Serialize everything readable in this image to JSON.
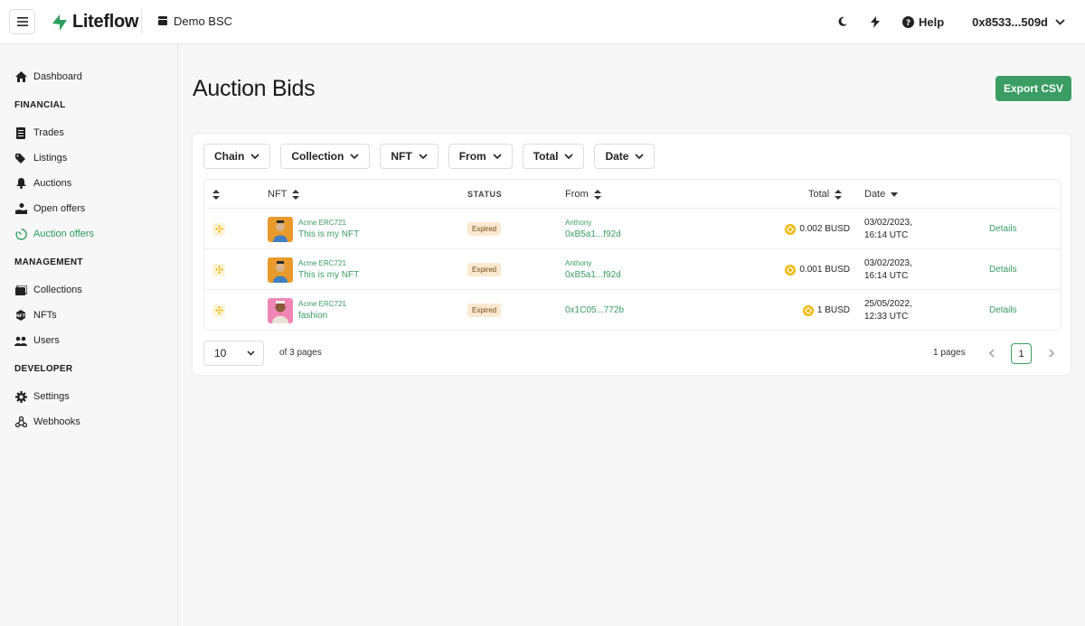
{
  "header": {
    "brand": "Liteflow",
    "environment": "Demo BSC",
    "help_label": "Help",
    "wallet": "0x8533...509d"
  },
  "sidebar": {
    "items_top": [
      {
        "label": "Dashboard",
        "icon": "home-icon"
      }
    ],
    "sections": [
      {
        "title": "FINANCIAL",
        "items": [
          {
            "label": "Trades",
            "icon": "document-icon"
          },
          {
            "label": "Listings",
            "icon": "tag-icon"
          },
          {
            "label": "Auctions",
            "icon": "bell-icon"
          },
          {
            "label": "Open offers",
            "icon": "hand-offer-icon"
          },
          {
            "label": "Auction offers",
            "icon": "timer-icon",
            "active": true
          }
        ]
      },
      {
        "title": "MANAGEMENT",
        "items": [
          {
            "label": "Collections",
            "icon": "images-icon"
          },
          {
            "label": "NFTs",
            "icon": "nft-icon"
          },
          {
            "label": "Users",
            "icon": "users-icon"
          }
        ]
      },
      {
        "title": "DEVELOPER",
        "items": [
          {
            "label": "Settings",
            "icon": "gear-icon"
          },
          {
            "label": "Webhooks",
            "icon": "webhook-icon"
          }
        ]
      }
    ]
  },
  "main": {
    "title": "Auction Bids",
    "export_label": "Export CSV",
    "filters": [
      "Chain",
      "Collection",
      "NFT",
      "From",
      "Total",
      "Date"
    ],
    "columns": {
      "nft": "NFT",
      "status": "STATUS",
      "from": "From",
      "total": "Total",
      "date": "Date"
    },
    "rows": [
      {
        "collection": "Acme ERC721",
        "nft": "This is my NFT",
        "status": "Expired",
        "from_name": "Anthony",
        "from_addr": "0xB5a1...f92d",
        "total": "0.002 BUSD",
        "date_line1": "03/02/2023,",
        "date_line2": "16:14 UTC",
        "action": "Details",
        "thumb": "orange"
      },
      {
        "collection": "Acme ERC721",
        "nft": "This is my NFT",
        "status": "Expired",
        "from_name": "Anthony",
        "from_addr": "0xB5a1...f92d",
        "total": "0.001 BUSD",
        "date_line1": "03/02/2023,",
        "date_line2": "16:14 UTC",
        "action": "Details",
        "thumb": "orange"
      },
      {
        "collection": "Acme ERC721",
        "nft": "fashion",
        "status": "Expired",
        "from_name": "",
        "from_addr": "0x1C05...772b",
        "total": "1 BUSD",
        "date_line1": "25/05/2022,",
        "date_line2": "12:33 UTC",
        "action": "Details",
        "thumb": "pink"
      }
    ],
    "pagination": {
      "per_page": "10",
      "of_pages": "of 3 pages",
      "pages_count": "1 pages",
      "current_page": "1"
    }
  },
  "colors": {
    "accent": "#3a9d63",
    "badge_bg": "#fde8cf",
    "coin": "#f0b90b"
  }
}
